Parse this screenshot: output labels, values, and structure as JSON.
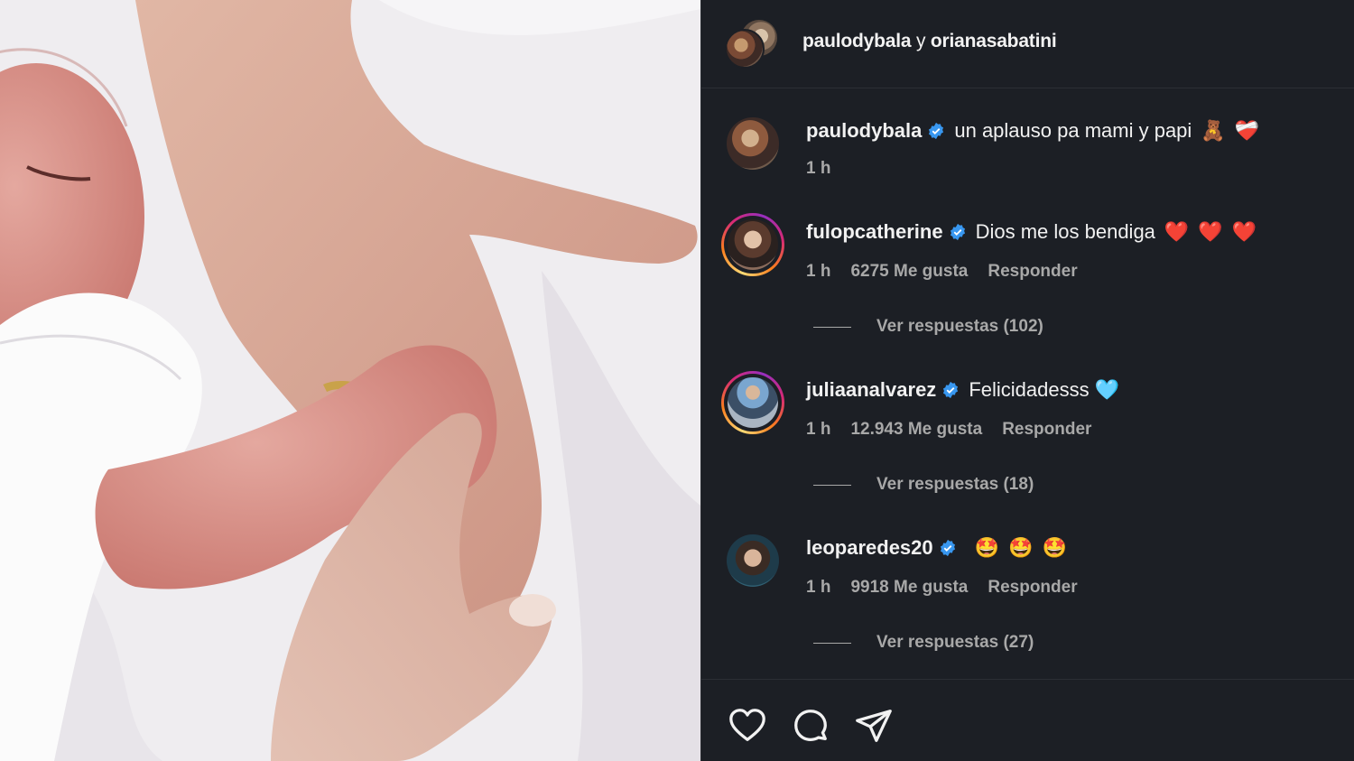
{
  "header": {
    "user1": "paulodybala",
    "sep": " y ",
    "user2": "orianasabatini"
  },
  "caption": {
    "username": "paulodybala",
    "text": "un aplauso pa mami y papi",
    "emojis": [
      "🧸",
      "❤️‍🩹"
    ],
    "time": "1 h"
  },
  "comments": [
    {
      "username": "fulopcatherine",
      "text": "Dios me los bendiga",
      "emojis": [
        "❤️",
        "❤️",
        "❤️"
      ],
      "time": "1 h",
      "likes": "6275 Me gusta",
      "reply": "Responder",
      "view_replies": "Ver respuestas (102)"
    },
    {
      "username": "juliaanalvarez",
      "text": "Felicidadesss 🩵",
      "emojis": [],
      "time": "1 h",
      "likes": "12.943 Me gusta",
      "reply": "Responder",
      "view_replies": "Ver respuestas (18)"
    },
    {
      "username": "leoparedes20",
      "text": "",
      "emojis": [
        "🤩",
        "🤩",
        "🤩"
      ],
      "time": "1 h",
      "likes": "9918 Me gusta",
      "reply": "Responder",
      "view_replies": "Ver respuestas (27)"
    }
  ],
  "colors": {
    "panel_bg": "#1c1f25",
    "verified": "#3897f0",
    "muted": "#a8a8a8"
  },
  "icons": [
    "heart-icon",
    "comment-icon",
    "share-icon",
    "verified-badge-icon"
  ]
}
